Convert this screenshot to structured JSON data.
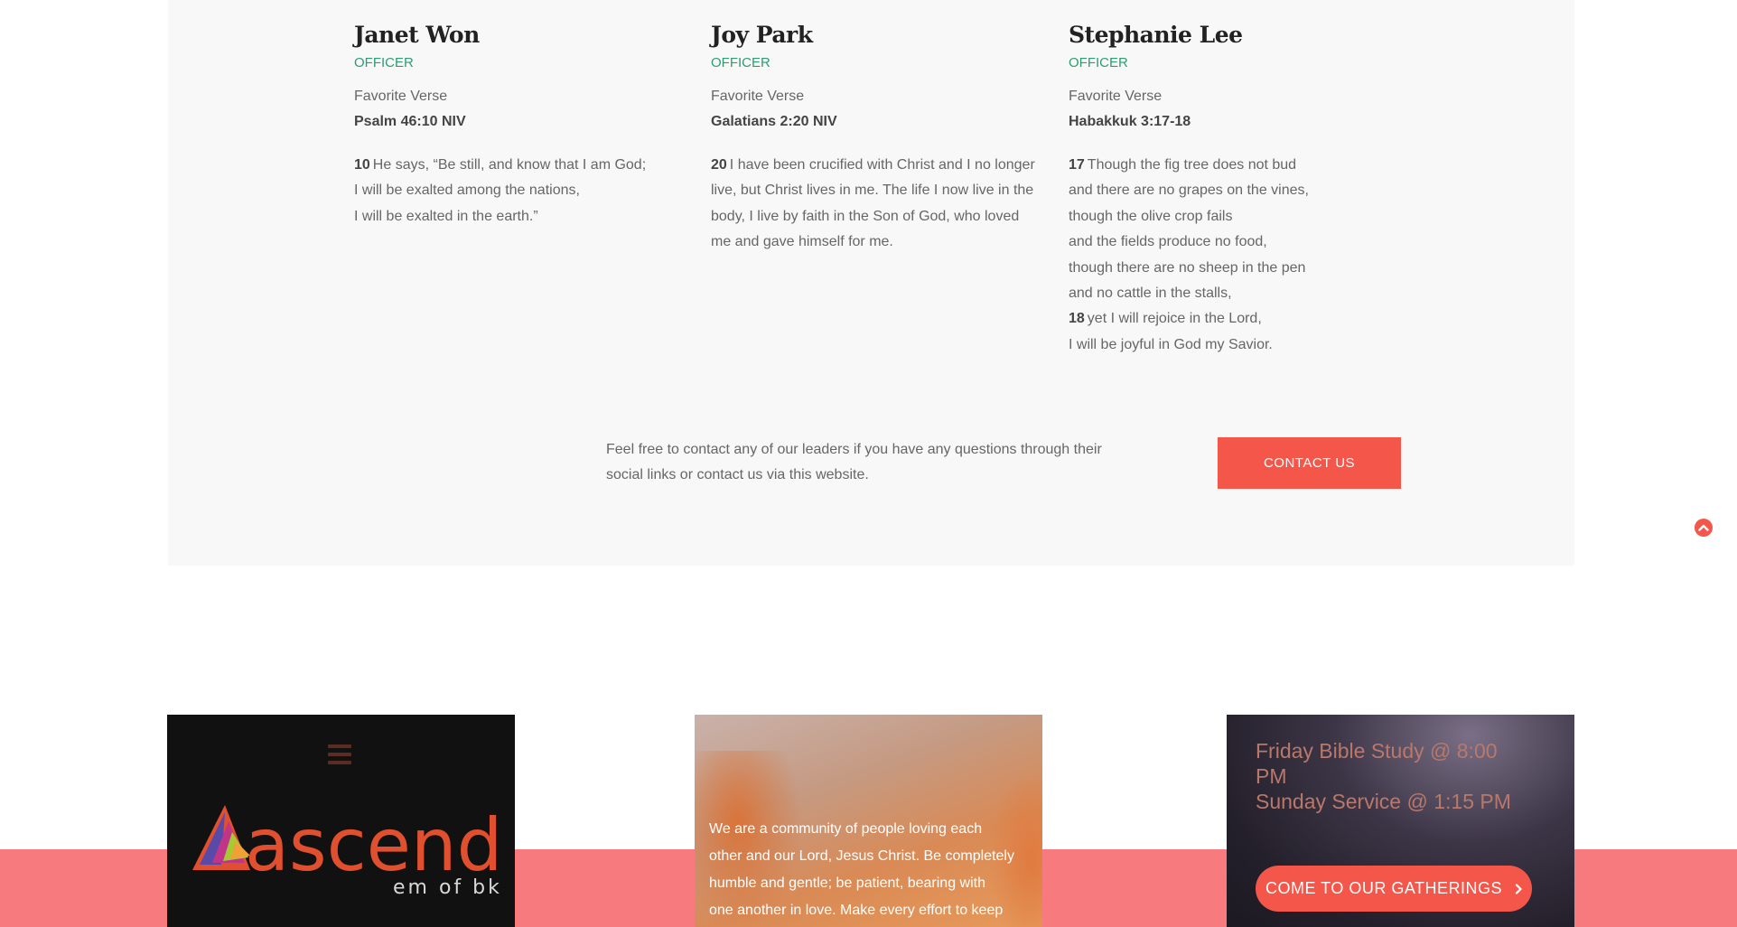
{
  "members": [
    {
      "name": "Janet Won",
      "role": "OFFICER",
      "verse_label": "Favorite Verse",
      "verse_ref": "Psalm 46:10 NIV",
      "verse_lines": [
        {
          "num": "10",
          "text": "He says, “Be still, and know that I am God;"
        },
        {
          "num": "",
          "text": "I will be exalted among the nations,"
        },
        {
          "num": "",
          "text": "I will be exalted in the earth.”"
        }
      ]
    },
    {
      "name": "Joy Park",
      "role": "OFFICER",
      "verse_label": "Favorite Verse",
      "verse_ref": "Galatians 2:20 NIV",
      "verse_lines": [
        {
          "num": "20",
          "text": "I have been crucified with Christ and I no longer"
        },
        {
          "num": "",
          "text": "live, but Christ lives in me. The life I now live in the"
        },
        {
          "num": "",
          "text": "body, I live by faith in the Son of God, who loved"
        },
        {
          "num": "",
          "text": "me and gave himself for me."
        }
      ]
    },
    {
      "name": "Stephanie Lee",
      "role": "OFFICER",
      "verse_label": "Favorite Verse",
      "verse_ref": "Habakkuk 3:17-18",
      "verse_lines": [
        {
          "num": "17",
          "text": "Though the fig tree does not bud"
        },
        {
          "num": "",
          "text": "and there are no grapes on the vines,"
        },
        {
          "num": "",
          "text": "though the olive crop fails"
        },
        {
          "num": "",
          "text": "and the fields produce no food,"
        },
        {
          "num": "",
          "text": "though there are no sheep in the pen"
        },
        {
          "num": "",
          "text": "and no cattle in the stalls,"
        },
        {
          "num": "18",
          "text": "yet I will rejoice in the Lord,"
        },
        {
          "num": "",
          "text": "I will be joyful in God my Savior."
        }
      ]
    }
  ],
  "contact": {
    "text_line1": "Feel free to contact any of our leaders if you have any questions through their",
    "text_line2": "social links or contact us via this website.",
    "button_label": "CONTACT US"
  },
  "back_to_top_icon": "chevron-up-icon",
  "logo": {
    "word": "ascend",
    "subtitle": "em of bkc",
    "brand_color": "#e0502f"
  },
  "community": {
    "lines": [
      "We are a community of people loving each",
      "other and our Lord, Jesus Christ. Be completely",
      "humble and gentle; be patient, bearing with",
      "one another in love. Make every effort to keep"
    ]
  },
  "gatherings": {
    "lines": [
      "Friday Bible Study @ 8:00",
      "PM",
      "Sunday Service @ 1:15 PM"
    ],
    "button_label": "COME TO OUR GATHERINGS"
  },
  "colors": {
    "accent": "#f5564a",
    "officer_green": "#2e9b73",
    "band_pink": "#f77b7e"
  }
}
